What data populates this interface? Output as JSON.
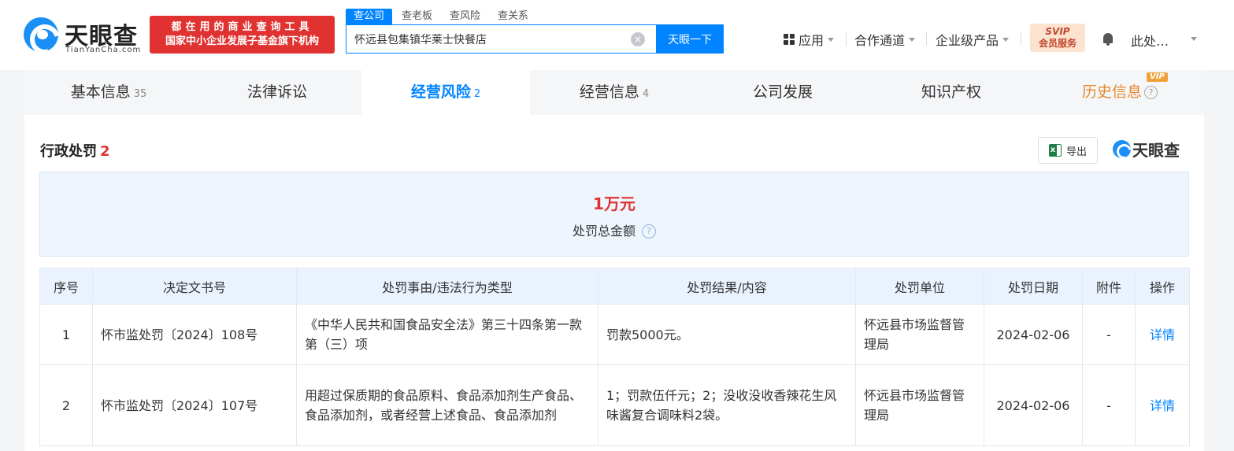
{
  "header": {
    "logo_text": "天眼查",
    "logo_sub": "TianYanCha.com",
    "slogan_line1": "都在用的商业查询工具",
    "slogan_line2": "国家中小企业发展子基金旗下机构",
    "search_tabs": [
      "查公司",
      "查老板",
      "查风险",
      "查关系"
    ],
    "search_value": "怀远县包集镇华莱士快餐店",
    "search_button": "天眼一下",
    "nav_apps": "应用",
    "nav_coop": "合作通道",
    "nav_enterprise": "企业级产品",
    "svip_line1": "SVIP",
    "svip_line2": "会员服务",
    "user_name": "此处…"
  },
  "tabs": [
    {
      "label": "基本信息",
      "count": "35"
    },
    {
      "label": "法律诉讼",
      "count": ""
    },
    {
      "label": "经营风险",
      "count": "2"
    },
    {
      "label": "经营信息",
      "count": "4"
    },
    {
      "label": "公司发展",
      "count": ""
    },
    {
      "label": "知识产权",
      "count": ""
    },
    {
      "label": "历史信息",
      "count": "",
      "badge": "VIP"
    }
  ],
  "section": {
    "title": "行政处罚",
    "count": "2",
    "export_label": "导出",
    "watermark": "天眼查"
  },
  "summary": {
    "amount": "1万元",
    "label": "处罚总金额"
  },
  "table": {
    "headers": [
      "序号",
      "决定文书号",
      "处罚事由/违法行为类型",
      "处罚结果/内容",
      "处罚单位",
      "处罚日期",
      "附件",
      "操作"
    ],
    "rows": [
      {
        "index": "1",
        "doc_no": "怀市监处罚〔2024〕108号",
        "reason": "《中华人民共和国食品安全法》第三十四条第一款第（三）项",
        "result": "罚款5000元。",
        "unit": "怀远县市场监督管理局",
        "date": "2024-02-06",
        "attachment": "-",
        "action": "详情"
      },
      {
        "index": "2",
        "doc_no": "怀市监处罚〔2024〕107号",
        "reason": "用超过保质期的食品原料、食品添加剂生产食品、食品添加剂，或者经营上述食品、食品添加剂",
        "result": "1；罚款伍仟元；2；没收没收香辣花生风味酱复合调味料2袋。",
        "unit": "怀远县市场监督管理局",
        "date": "2024-02-06",
        "attachment": "-",
        "action": "详情"
      }
    ]
  }
}
